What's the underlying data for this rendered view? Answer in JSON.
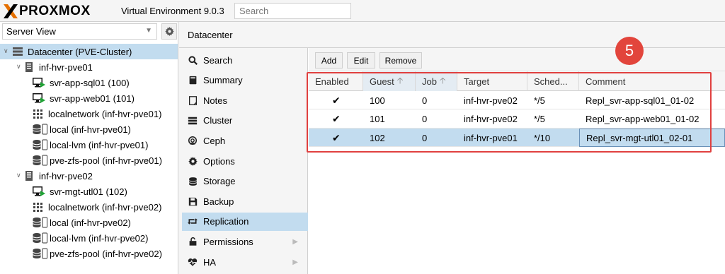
{
  "app": {
    "logo_text": "PROXMOX",
    "version_label": "Virtual Environment 9.0.3",
    "search_placeholder": "Search",
    "brand_color": "#e57000"
  },
  "left_panel": {
    "view_selector": "Server View",
    "tree": [
      {
        "label": "Datacenter (PVE-Cluster)",
        "icon": "datacenter-icon",
        "selected": true
      },
      {
        "label": "inf-hvr-pve01",
        "icon": "node-icon"
      },
      {
        "label": "svr-app-sql01 (100)",
        "icon": "vm-running-icon"
      },
      {
        "label": "svr-app-web01 (101)",
        "icon": "vm-running-icon"
      },
      {
        "label": "localnetwork (inf-hvr-pve01)",
        "icon": "sdn-icon"
      },
      {
        "label": "local (inf-hvr-pve01)",
        "icon": "storage-icon"
      },
      {
        "label": "local-lvm (inf-hvr-pve01)",
        "icon": "storage-icon"
      },
      {
        "label": "pve-zfs-pool (inf-hvr-pve01)",
        "icon": "storage-icon"
      },
      {
        "label": "inf-hvr-pve02",
        "icon": "node-icon"
      },
      {
        "label": "svr-mgt-utl01 (102)",
        "icon": "vm-running-icon"
      },
      {
        "label": "localnetwork (inf-hvr-pve02)",
        "icon": "sdn-icon"
      },
      {
        "label": "local (inf-hvr-pve02)",
        "icon": "storage-icon"
      },
      {
        "label": "local-lvm (inf-hvr-pve02)",
        "icon": "storage-icon"
      },
      {
        "label": "pve-zfs-pool (inf-hvr-pve02)",
        "icon": "storage-icon"
      }
    ]
  },
  "content": {
    "title": "Datacenter",
    "nav": [
      {
        "label": "Search",
        "icon": "search-icon"
      },
      {
        "label": "Summary",
        "icon": "book-icon"
      },
      {
        "label": "Notes",
        "icon": "notes-icon"
      },
      {
        "label": "Cluster",
        "icon": "server-icon"
      },
      {
        "label": "Ceph",
        "icon": "ceph-icon"
      },
      {
        "label": "Options",
        "icon": "gear-icon"
      },
      {
        "label": "Storage",
        "icon": "database-icon"
      },
      {
        "label": "Backup",
        "icon": "floppy-icon"
      },
      {
        "label": "Replication",
        "icon": "retweet-icon",
        "selected": true
      },
      {
        "label": "Permissions",
        "icon": "unlock-icon",
        "expandable": true
      },
      {
        "label": "HA",
        "icon": "heartbeat-icon",
        "expandable": true
      }
    ]
  },
  "replication": {
    "toolbar": {
      "add": "Add",
      "edit": "Edit",
      "remove": "Remove"
    },
    "columns": {
      "enabled": "Enabled",
      "guest": "Guest",
      "job": "Job",
      "target": "Target",
      "schedule": "Sched...",
      "comment": "Comment"
    },
    "rows": [
      {
        "enabled": "✔",
        "guest": "100",
        "job": "0",
        "target": "inf-hvr-pve02",
        "schedule": "*/5",
        "comment": "Repl_svr-app-sql01_01-02"
      },
      {
        "enabled": "✔",
        "guest": "101",
        "job": "0",
        "target": "inf-hvr-pve02",
        "schedule": "*/5",
        "comment": "Repl_svr-app-web01_01-02"
      },
      {
        "enabled": "✔",
        "guest": "102",
        "job": "0",
        "target": "inf-hvr-pve01",
        "schedule": "*/10",
        "comment": "Repl_svr-mgt-utl01_02-01",
        "selected": true
      }
    ],
    "callout_number": "5",
    "callout_color": "#e2453c"
  }
}
